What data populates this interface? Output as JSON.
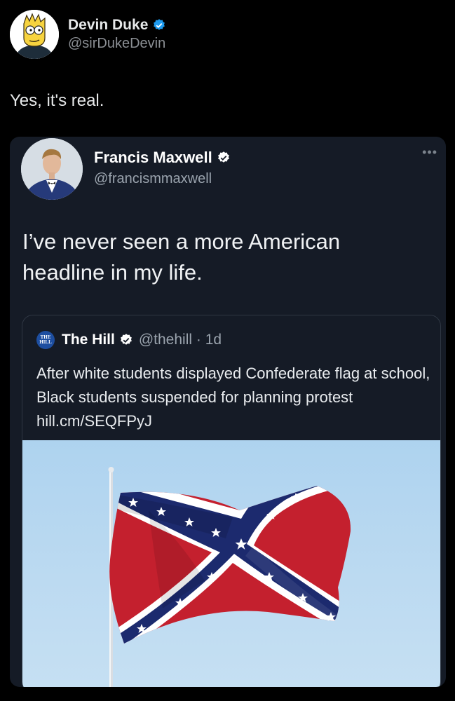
{
  "outer_tweet": {
    "display_name": "Devin Duke",
    "handle": "@sirDukeDevin",
    "text": "Yes, it's real."
  },
  "inner_tweet": {
    "display_name": "Francis Maxwell",
    "handle": "@francismmaxwell",
    "text": "I’ve never seen a more American headline in my life."
  },
  "quoted_tweet": {
    "logo_text": "THE HILL",
    "display_name": "The Hill",
    "handle": "@thehill · 1d",
    "text": "After white students displayed Confederate flag at school, Black students suspended for planning protest hill.cm/SEQFPyJ"
  },
  "colors": {
    "background": "#000000",
    "card": "#151b26",
    "verified": "#1d9bf0",
    "flag_red": "#c4202e",
    "flag_blue": "#1c2a6e"
  },
  "icons": [
    "verified-badge-icon",
    "more-options-icon",
    "the-hill-logo-icon"
  ]
}
